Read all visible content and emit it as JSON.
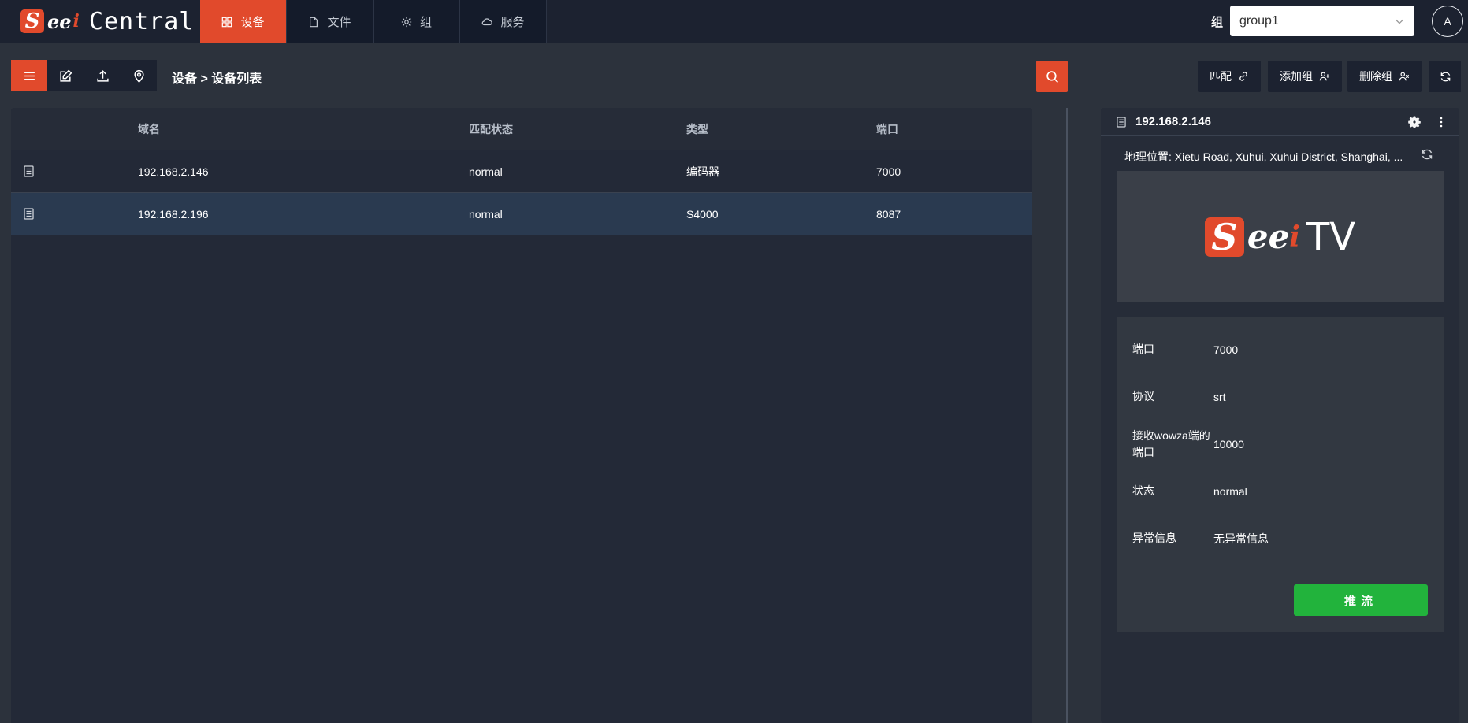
{
  "app": {
    "logo_letter": "S",
    "logo_ee": "ee",
    "logo_i": "i",
    "name": "Central"
  },
  "nav": {
    "tabs": [
      {
        "label": "设备",
        "icon": "dashboard-icon",
        "active": true
      },
      {
        "label": "文件",
        "icon": "file-icon",
        "active": false
      },
      {
        "label": "组",
        "icon": "gear-icon",
        "active": false
      },
      {
        "label": "服务",
        "icon": "cloud-icon",
        "active": false
      }
    ],
    "group_label": "组",
    "group_value": "group1",
    "avatar": "A"
  },
  "toolbar": {
    "breadcrumb": "设备 > 设备列表",
    "buttons": [
      {
        "label": "匹配",
        "icon": "link-icon"
      },
      {
        "label": "添加组",
        "icon": "add-user-icon"
      },
      {
        "label": "删除组",
        "icon": "remove-user-icon"
      }
    ]
  },
  "table": {
    "columns": [
      "域名",
      "匹配状态",
      "类型",
      "端口"
    ],
    "rows": [
      {
        "domain": "192.168.2.146",
        "status": "normal",
        "type": "编码器",
        "port": "7000",
        "selected": false
      },
      {
        "domain": "192.168.2.196",
        "status": "normal",
        "type": "S4000",
        "port": "8087",
        "selected": true
      }
    ]
  },
  "detail": {
    "title": "192.168.2.146",
    "location": "地理位置: Xietu Road, Xuhui, Xuhui District, Shanghai, ...",
    "logo": {
      "letter": "S",
      "ee": "ee",
      "i": "i",
      "tv": "TV"
    },
    "fields": [
      {
        "label": "端口",
        "value": "7000"
      },
      {
        "label": "协议",
        "value": "srt"
      },
      {
        "label": "接收wowza端的端口",
        "value": "10000"
      },
      {
        "label": "状态",
        "value": "normal"
      },
      {
        "label": "异常信息",
        "value": "无异常信息"
      }
    ],
    "push_button": "推流"
  },
  "colors": {
    "accent": "#e14a2c",
    "success": "#22b33c",
    "bg": "#2c323c",
    "panel": "#232937"
  }
}
